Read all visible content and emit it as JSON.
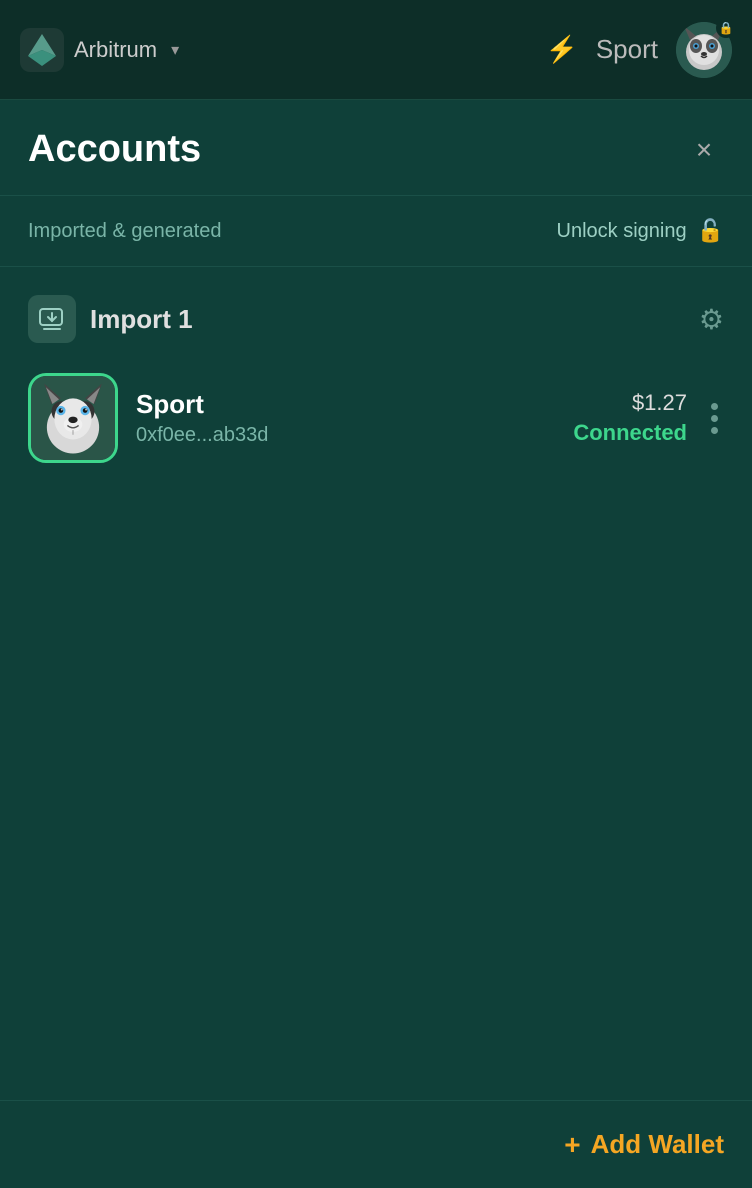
{
  "nav": {
    "logo_alt": "Arbitrum logo",
    "network": "Arbitrum",
    "chevron": "▾",
    "lightning": "⚡",
    "sport_label": "Sport",
    "lock_icon": "🔒"
  },
  "accounts": {
    "title": "Accounts",
    "close_label": "×",
    "filter_label": "Imported & generated",
    "unlock_signing_label": "Unlock signing",
    "import_group_name": "Import 1",
    "import_icon": "↩",
    "gear_icon": "⚙",
    "account": {
      "name": "Sport",
      "address": "0xf0ee...ab33d",
      "balance": "$1.27",
      "status": "Connected",
      "more_dots": [
        "•",
        "•",
        "•"
      ]
    },
    "add_wallet_label": "Add Wallet",
    "plus_icon": "+"
  }
}
